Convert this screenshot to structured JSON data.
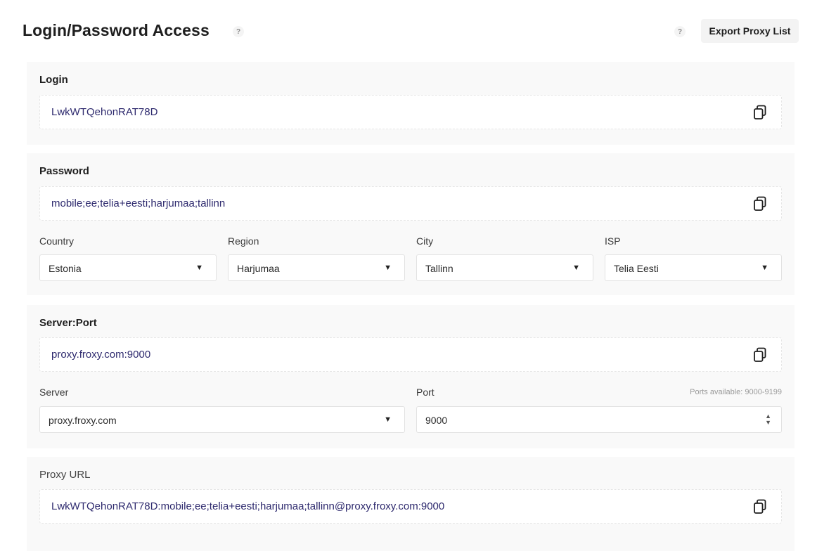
{
  "header": {
    "title": "Login/Password Access",
    "help_glyph": "?",
    "export_label": "Export Proxy List"
  },
  "login": {
    "label": "Login",
    "value": "LwkWTQehonRAT78D"
  },
  "password": {
    "label": "Password",
    "value": "mobile;ee;telia+eesti;harjumaa;tallinn",
    "filters": {
      "country": {
        "label": "Country",
        "value": "Estonia"
      },
      "region": {
        "label": "Region",
        "value": "Harjumaa"
      },
      "city": {
        "label": "City",
        "value": "Tallinn"
      },
      "isp": {
        "label": "ISP",
        "value": "Telia Eesti"
      }
    }
  },
  "server_port": {
    "label": "Server:Port",
    "value": "proxy.froxy.com:9000",
    "server": {
      "label": "Server",
      "value": "proxy.froxy.com"
    },
    "port": {
      "label": "Port",
      "value": "9000",
      "hint": "Ports available: 9000-9199"
    }
  },
  "proxy_url": {
    "label": "Proxy URL",
    "value": "LwkWTQehonRAT78D:mobile;ee;telia+eesti;harjumaa;tallinn@proxy.froxy.com:9000"
  },
  "icons": {
    "copy": "copy-icon",
    "help": "help-icon",
    "dropdown": "caret-down-icon",
    "stepper": "number-stepper-icon"
  },
  "colors": {
    "value_text": "#2e2a6e",
    "section_bg": "#f9f9f9",
    "button_bg": "#f3f3f3"
  }
}
